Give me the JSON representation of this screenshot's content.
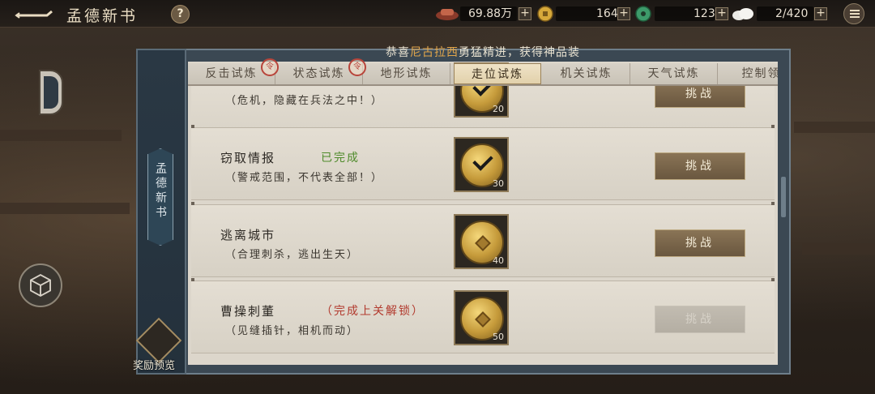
{
  "header": {
    "title": "孟德新书",
    "help_label": "?",
    "resources": [
      {
        "icon": "silver-ingot-icon",
        "value": "69.88万"
      },
      {
        "icon": "gold-coin-icon",
        "value": "164"
      },
      {
        "icon": "jade-icon",
        "value": "123"
      },
      {
        "icon": "stamina-cloud-icon",
        "value": "2/420"
      }
    ],
    "plus_label": "+"
  },
  "announcement": {
    "prefix": "恭喜",
    "player": "尼古拉西",
    "suffix": "勇猛精进，获得神品装"
  },
  "tabs": [
    {
      "label": "反击试炼",
      "active": false
    },
    {
      "label": "状态试炼",
      "active": false
    },
    {
      "label": "地形试炼",
      "active": false
    },
    {
      "label": "走位试炼",
      "active": true
    },
    {
      "label": "机关试炼",
      "active": false
    },
    {
      "label": "天气试炼",
      "active": false
    },
    {
      "label": "控制领",
      "active": false
    }
  ],
  "side_panel": {
    "label": "孟德新书",
    "reward_preview": "奖励预览"
  },
  "rows": [
    {
      "name": "",
      "status": "",
      "desc": "（危机，隐藏在兵法之中！）",
      "reward": "20",
      "completed": true,
      "button": "挑战",
      "enabled": true
    },
    {
      "name": "窃取情报",
      "status": "已完成",
      "desc": "（警戒范围，不代表全部！）",
      "reward": "30",
      "completed": true,
      "button": "挑战",
      "enabled": true
    },
    {
      "name": "逃离城市",
      "status": "",
      "desc": "（合理刺杀，逃出生天）",
      "reward": "40",
      "completed": false,
      "button": "挑战",
      "enabled": true
    },
    {
      "name": "曹操刺董",
      "status": "（完成上关解锁）",
      "desc": "（见缝插针，相机而动）",
      "reward": "50",
      "completed": false,
      "button": "挑战",
      "enabled": false
    }
  ],
  "colors": {
    "completed_status": "#4e8a2a",
    "locked_status": "#b23a2e",
    "highlight_name": "#e2a64b"
  }
}
